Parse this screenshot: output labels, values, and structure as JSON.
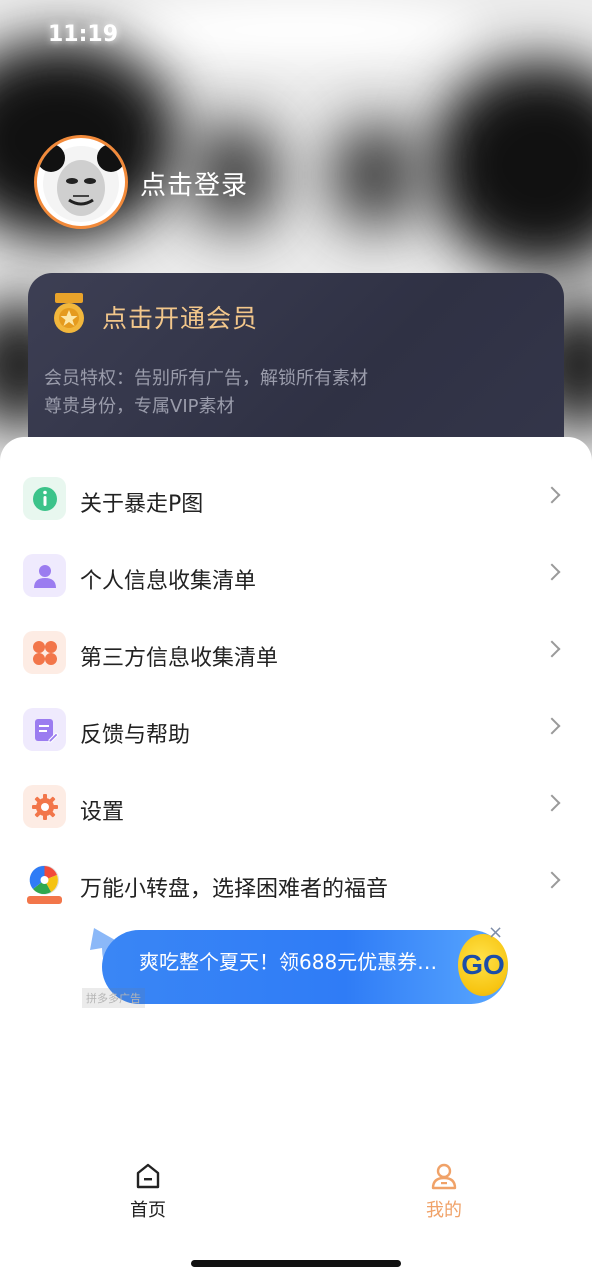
{
  "status_bar": {
    "time": "11:19"
  },
  "header": {
    "login_text": "点击登录"
  },
  "vip_card": {
    "title": "点击开通会员",
    "desc_line1": "会员特权：告别所有广告，解锁所有素材",
    "desc_line2": "尊贵身份，专属VIP素材"
  },
  "menu": {
    "items": [
      {
        "label": "关于暴走P图",
        "icon": "info-icon",
        "color": "#3cc38a"
      },
      {
        "label": "个人信息收集清单",
        "icon": "person-icon",
        "color": "#9b7cf0"
      },
      {
        "label": "第三方信息收集清单",
        "icon": "grid-icon",
        "color": "#f2764a"
      },
      {
        "label": "反馈与帮助",
        "icon": "document-edit-icon",
        "color": "#9b7cf0"
      },
      {
        "label": "设置",
        "icon": "gear-icon",
        "color": "#f2764a"
      },
      {
        "label": "万能小转盘，选择困难者的福音",
        "icon": "spinner-wheel-icon",
        "color": "#f2764a"
      }
    ]
  },
  "ad_banner": {
    "text": "爽吃整个夏天！领688元优惠券…",
    "go_label": "GO",
    "close": "×",
    "tag": "拼多多广告"
  },
  "tab_bar": {
    "home_label": "首页",
    "mine_label": "我的",
    "active_color": "#f0a268",
    "inactive_color": "#222222"
  }
}
